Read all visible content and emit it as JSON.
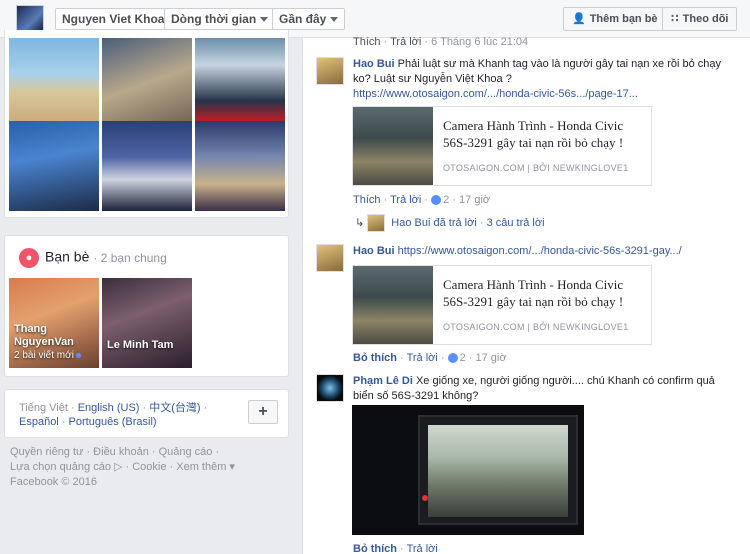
{
  "topbar": {
    "crumbs": [
      {
        "label": "Nguyen Viet Khoa"
      },
      {
        "label": "Dòng thời gian"
      },
      {
        "label": "Gần đây"
      }
    ],
    "add_friend_label": "Thêm bạn bè",
    "follow_label": "Theo dõi",
    "add_friend_icon": "add-friend-icon",
    "follow_icon": "rss-icon"
  },
  "friends": {
    "title": "Bạn bè",
    "mutual": "· 2 bạn chung",
    "items": [
      {
        "name": "Thang NguyenVan",
        "sub": "2 bài viết mới"
      },
      {
        "name": "Le Minh Tam",
        "sub": ""
      }
    ]
  },
  "languages": {
    "current": "Tiếng Việt",
    "others": [
      "English (US)",
      "中文(台灣)",
      "Español",
      "Português (Brasil)"
    ],
    "more_label": "+"
  },
  "footer": {
    "line1": "Quyền riêng tư · Điều khoản · Quảng cáo ·",
    "line2": "Lựa chọn quảng cáo ▷ · Cookie · Xem thêm ▾",
    "line3": "Facebook © 2016"
  },
  "feed": {
    "top_meta": {
      "like": "Thích",
      "reply": "Trả lời",
      "time": "6 Tháng 6 lúc 21:04"
    },
    "comments": [
      {
        "author": "Hao Bui",
        "text": "Phải luật sư mà Khanh tag vào là người gây tai nạn xe rồi bỏ chạy ko? Luật sư Nguyễn Việt Khoa ?",
        "url": "https://www.otosaigon.com/.../honda-civic-56s.../page-17...",
        "link_title": "Camera Hành Trình - Honda Civic 56S-3291 gây tai nạn rồi bỏ chạy !",
        "link_source": "OTOSAIGON.COM  |  BỞI NEWKINGLOVE1",
        "like": "Thích",
        "reply": "Trả lời",
        "likes": "2",
        "time": "17 giờ",
        "replied_by": "Hao Bui đã trả lời",
        "reply_count": "3 câu trả lời"
      },
      {
        "author": "Hao Bui",
        "url": "https://www.otosaigon.com/.../honda-civic-56s-3291-gay.../",
        "link_title": "Camera Hành Trình - Honda Civic 56S-3291 gây tai nạn rồi bỏ chạy !",
        "link_source": "OTOSAIGON.COM  |  BỞI NEWKINGLOVE1",
        "like": "Bỏ thích",
        "reply": "Trả lời",
        "likes": "2",
        "time": "17 giờ"
      },
      {
        "author": "Phạm Lê Di",
        "text": "Xe giống xe, người giống người.... chú Khanh có confirm quả biển số 56S-3291 không?",
        "like": "Bỏ thích",
        "reply": "Trả lời"
      }
    ]
  },
  "colors": {
    "accent": "#365899",
    "friends_badge": "#f35369",
    "background": "#e9ebee"
  }
}
